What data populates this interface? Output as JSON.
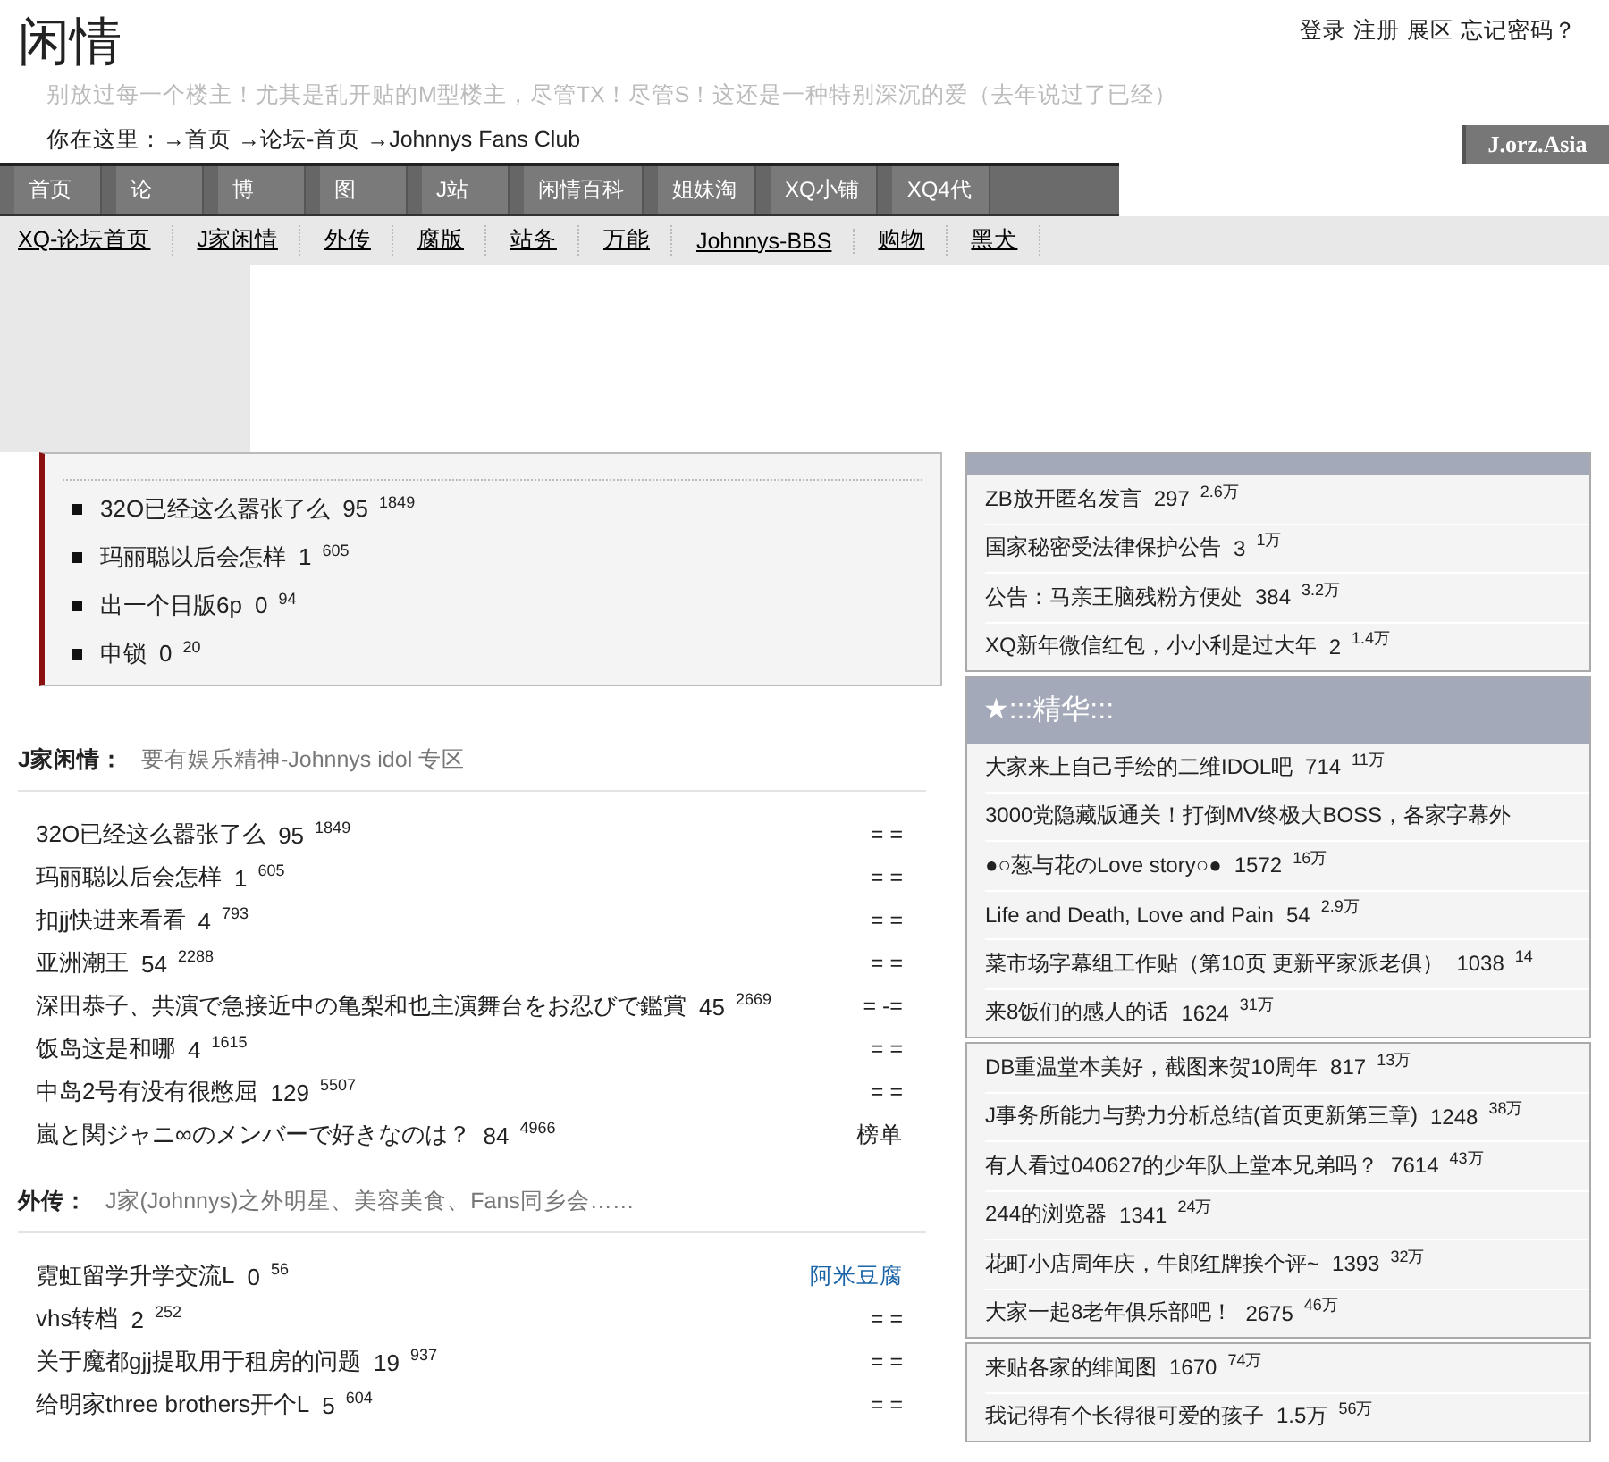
{
  "site": {
    "title": "闲情",
    "top_links": [
      "登录",
      "注册",
      "展区",
      "忘记密码？"
    ],
    "slogan": "别放过每一个楼主！尤其是乱开贴的M型楼主，尽管TX！尽管S！这还是一种特别深沉的爱（去年说过了已经）",
    "breadcrumb": "你在这里：→首页 →论坛-首页 →Johnnys Fans Club",
    "badge": "J.orz.Asia"
  },
  "nav": [
    "首页",
    "论",
    "博",
    "图",
    "J站",
    "闲情百科",
    "姐妹淘",
    "XQ小铺",
    "XQ4代"
  ],
  "subnav": [
    "XQ-论坛首页",
    "J家闲情",
    "外传",
    "腐版",
    "站务",
    "万能",
    "Johnnys-BBS",
    "购物",
    "黑犬"
  ],
  "hot_box": {
    "items": [
      {
        "title": "32O已经这么嚣张了么",
        "replies": "95",
        "views": "1849"
      },
      {
        "title": "玛丽聪以后会怎样",
        "replies": "1",
        "views": "605"
      },
      {
        "title": "出一个日版6p",
        "replies": "0",
        "views": "94"
      },
      {
        "title": "申锁",
        "replies": "0",
        "views": "20"
      }
    ]
  },
  "sections": [
    {
      "name": "J家闲情：",
      "desc": "要有娱乐精神-Johnnys idol 专区",
      "rows": [
        {
          "title": "32O已经这么嚣张了么",
          "replies": "95",
          "views": "1849",
          "tail": "= =",
          "kind": "plain"
        },
        {
          "title": "玛丽聪以后会怎样",
          "replies": "1",
          "views": "605",
          "tail": "= =",
          "kind": "plain"
        },
        {
          "title": "扣jj快进来看看",
          "replies": "4",
          "views": "793",
          "tail": "= =",
          "kind": "plain"
        },
        {
          "title": "亚洲潮王",
          "replies": "54",
          "views": "2288",
          "tail": "= =",
          "kind": "plain"
        },
        {
          "title": "深田恭子、共演で急接近中の亀梨和也主演舞台をお忍びで鑑賞",
          "replies": "45",
          "views": "2669",
          "tail": "= -=",
          "kind": "plain"
        },
        {
          "title": "饭岛这是和哪",
          "replies": "4",
          "views": "1615",
          "tail": "= =",
          "kind": "plain"
        },
        {
          "title": "中岛2号有没有很憋屈",
          "replies": "129",
          "views": "5507",
          "tail": "= =",
          "kind": "plain"
        },
        {
          "title": "嵐と関ジャニ∞のメンバーで好きなのは？",
          "replies": "84",
          "views": "4966",
          "tail": "榜单",
          "kind": "plain"
        }
      ]
    },
    {
      "name": "外传：",
      "desc": "J家(Johnnys)之外明星、美容美食、Fans同乡会……",
      "rows": [
        {
          "title": "霓虹留学升学交流L",
          "replies": "0",
          "views": "56",
          "tail": "阿米豆腐",
          "kind": "link"
        },
        {
          "title": "vhs转档",
          "replies": "2",
          "views": "252",
          "tail": "= =",
          "kind": "plain"
        },
        {
          "title": "关于魔都gjj提取用于租房的问题",
          "replies": "19",
          "views": "937",
          "tail": "= =",
          "kind": "plain"
        },
        {
          "title": "给明家three brothers开个L",
          "replies": "5",
          "views": "604",
          "tail": "= =",
          "kind": "plain"
        }
      ]
    }
  ],
  "panels": [
    {
      "kind": "banded",
      "rows": [
        {
          "title": "ZB放开匿名发言",
          "replies": "297",
          "views": "2.6万"
        },
        {
          "title": "国家秘密受法律保护公告",
          "replies": "3",
          "views": "1万"
        },
        {
          "title": "公告：马亲王脑残粉方便处",
          "replies": "384",
          "views": "3.2万"
        },
        {
          "title": "XQ新年微信红包，小小利是过大年",
          "replies": "2",
          "views": "1.4万"
        }
      ]
    },
    {
      "kind": "titled",
      "title": "★:::精华:::",
      "rows": [
        {
          "title": "大家来上自己手绘的二维IDOL吧",
          "replies": "714",
          "views": "11万"
        },
        {
          "title": "3000党隐藏版通关！打倒MV终极大BOSS，各家字幕外"
        },
        {
          "title": "●○葱与花のLove story○●",
          "replies": "1572",
          "views": "16万"
        },
        {
          "title": "Life and Death, Love and Pain",
          "replies": "54",
          "views": "2.9万"
        },
        {
          "title": "菜市场字幕组工作贴（第10页 更新平家派老俱）",
          "replies": "1038",
          "views": "14"
        },
        {
          "title": "来8饭们的感人的话",
          "replies": "1624",
          "views": "31万"
        }
      ]
    },
    {
      "kind": "plain",
      "rows": [
        {
          "title": "DB重温堂本美好，截图来贺10周年",
          "replies": "817",
          "views": "13万"
        },
        {
          "title": "J事务所能力与势力分析总结(首页更新第三章)",
          "replies": "1248",
          "views": "38万"
        },
        {
          "title": "有人看过040627的少年队上堂本兄弟吗？",
          "replies": "7614",
          "views": "43万"
        },
        {
          "title": "244的浏览器",
          "replies": "1341",
          "views": "24万"
        },
        {
          "title": "花町小店周年庆，牛郎红牌挨个评~",
          "replies": "1393",
          "views": "32万"
        },
        {
          "title": "大家一起8老年俱乐部吧！",
          "replies": "2675",
          "views": "46万"
        }
      ]
    },
    {
      "kind": "plain",
      "rows": [
        {
          "title": "来贴各家的绯闻图",
          "replies": "1670",
          "views": "74万"
        },
        {
          "title": "我记得有个长得很可爱的孩子",
          "replies": "1.5万",
          "views": "56万"
        }
      ]
    }
  ]
}
